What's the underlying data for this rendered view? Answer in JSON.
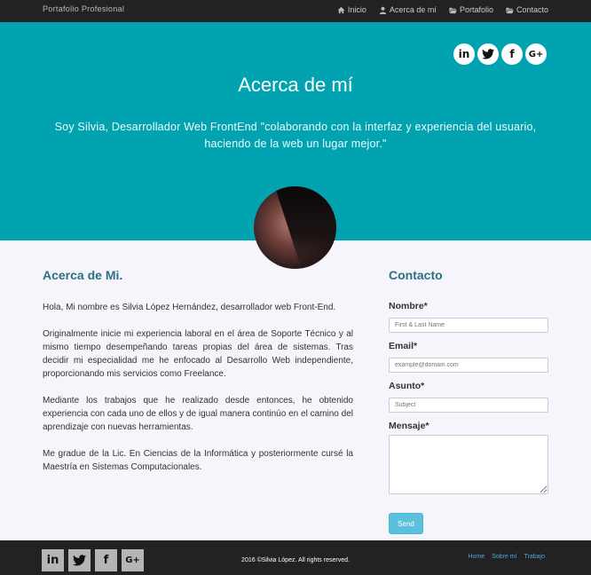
{
  "navbar": {
    "brand": "Portafolio Profesional",
    "items": [
      {
        "label": "Inicio",
        "icon": "home-icon"
      },
      {
        "label": "Acerca de mí",
        "icon": "user-icon"
      },
      {
        "label": "Portafolio",
        "icon": "folder-open-icon"
      },
      {
        "label": "Contacto",
        "icon": "folder-open-icon"
      }
    ]
  },
  "hero": {
    "title": "Acerca de mí",
    "text": "Soy Silvia, Desarrollador Web FrontEnd \"colaborando con la interfaz y experiencia del usuario, haciendo de la web un lugar mejor.\"",
    "social": [
      {
        "glyph": "in",
        "icon": "linkedin-icon"
      },
      {
        "glyph": "🐦",
        "icon": "twitter-icon"
      },
      {
        "glyph": "f",
        "icon": "facebook-icon"
      },
      {
        "glyph": "G+",
        "icon": "google-plus-icon"
      }
    ],
    "bg_color": "#02a3b1"
  },
  "about": {
    "title": "Acerca de Mi.",
    "paragraphs": [
      "Hola, Mi nombre es Silvia López Hernández, desarrollador web Front-End.",
      "Originalmente inicie mi experiencia laboral en el área de Soporte Técnico y al mismo tiempo desempeñando tareas propias del área de sistemas. Tras decidir mi especialidad me he enfocado al Desarrollo Web independiente, proporcionando mis servicios como Freelance.",
      "Mediante los trabajos que he realizado desde entonces, he obtenido experiencia con cada uno de ellos y de igual manera continúo en el camino del aprendizaje con nuevas herramientas.",
      "Me gradue de la Lic. En Ciencias de la Informática y posteriormente cursé la Maestría en Sistemas Computacionales."
    ]
  },
  "contact": {
    "title": "Contacto",
    "name_label": "Nombre*",
    "name_placeholder": "First & Last Name",
    "email_label": "Email*",
    "email_placeholder": "example@domain.com",
    "subject_label": "Asunto*",
    "subject_placeholder": "Subject",
    "message_label": "Mensaje*",
    "send_label": "Send"
  },
  "footer": {
    "copyright": "2016 ©Silvia López. All rights reserved.",
    "links": [
      "Home",
      "Sobre mí",
      "Trabajo"
    ],
    "social": [
      {
        "glyph": "in",
        "icon": "linkedin-icon"
      },
      {
        "glyph": "🐦",
        "icon": "twitter-icon"
      },
      {
        "glyph": "f",
        "icon": "facebook-icon"
      },
      {
        "glyph": "G+",
        "icon": "google-plus-icon"
      }
    ]
  }
}
